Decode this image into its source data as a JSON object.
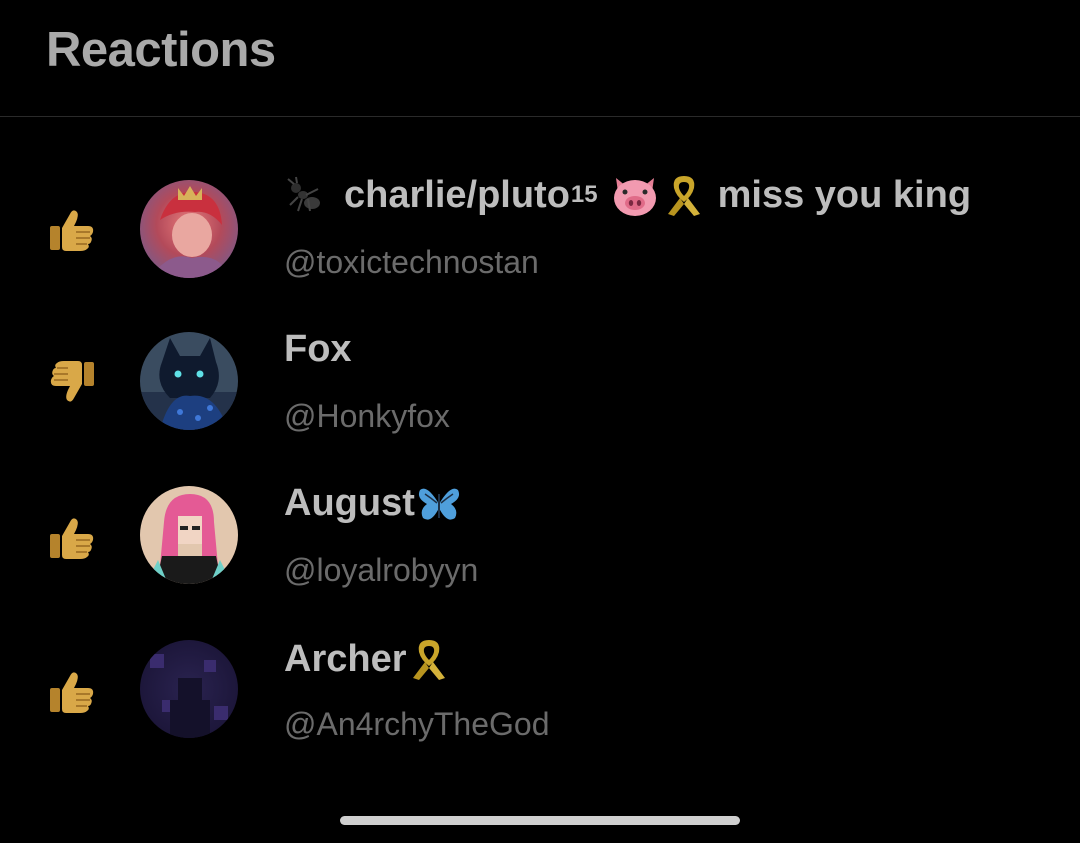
{
  "header": {
    "title": "Reactions"
  },
  "reactions": [
    {
      "reaction": "thumbs-up",
      "display_name_prefix": "charlie/pluto",
      "display_name_sup": "15",
      "display_name_suffix": "miss you king",
      "handle": "@toxictechnostan",
      "name_icons": [
        "ant-icon",
        "pig-face-icon",
        "yellow-ribbon-icon"
      ]
    },
    {
      "reaction": "thumbs-down",
      "display_name": "Fox",
      "handle": "@Honkyfox"
    },
    {
      "reaction": "thumbs-up",
      "display_name": "August",
      "handle": "@loyalrobyyn",
      "name_icons": [
        "butterfly-icon"
      ]
    },
    {
      "reaction": "thumbs-up",
      "display_name": "Archer",
      "handle": "@An4rchyTheGod",
      "name_icons": [
        "yellow-ribbon-icon"
      ]
    }
  ],
  "colors": {
    "background": "#000000",
    "title": "#a9a9a9",
    "name": "#bdbdbd",
    "handle": "#6b6b6b",
    "thumb": "#c99a3c",
    "ribbon": "#c9a52a",
    "butterfly": "#4f9fdc",
    "divider": "#2a2a2a"
  }
}
